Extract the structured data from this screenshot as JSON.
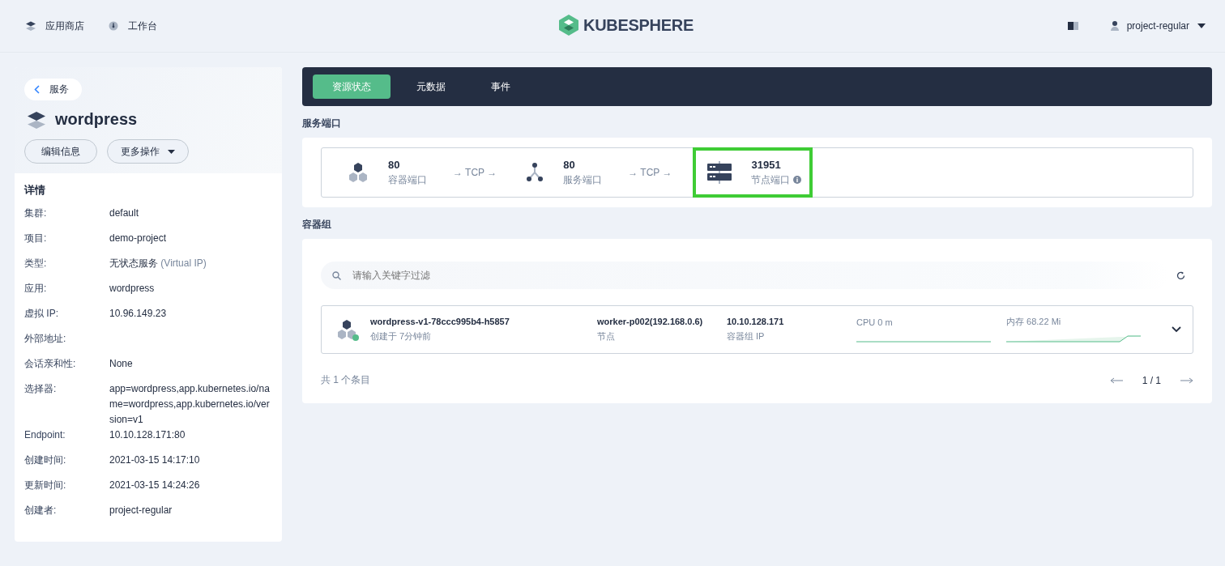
{
  "header": {
    "nav": [
      {
        "label": "应用商店",
        "kind": "store"
      },
      {
        "label": "工作台",
        "kind": "workbench"
      }
    ],
    "logo": "KUBESPHERE",
    "user": "project-regular"
  },
  "sidebar": {
    "back": "服务",
    "title": "wordpress",
    "buttons": [
      {
        "label": "编辑信息",
        "kind": "plain"
      },
      {
        "label": "更多操作",
        "kind": "dropdown"
      }
    ],
    "details_title": "详情",
    "details": [
      {
        "label": "集群:",
        "value": "default"
      },
      {
        "label": "项目:",
        "value": "demo-project"
      },
      {
        "label": "类型:",
        "value": "无状态服务",
        "note": "(Virtual IP)"
      },
      {
        "label": "应用:",
        "value": "wordpress"
      },
      {
        "label": "虚拟 IP:",
        "value": "10.96.149.23"
      },
      {
        "label": "外部地址:"
      },
      {
        "label": "会话亲和性:",
        "value": "None"
      },
      {
        "label": "选择器:",
        "value": "app=wordpress,app.kubernetes.io/name=wordpress,app.kubernetes.io/version=v1"
      },
      {
        "label": "Endpoint:",
        "value": "10.10.128.171:80"
      },
      {
        "label": "创建时间:",
        "value": "2021-03-15 14:17:10"
      },
      {
        "label": "更新时间:",
        "value": "2021-03-15 14:24:26"
      },
      {
        "label": "创建者:",
        "value": "project-regular"
      }
    ]
  },
  "tabs": [
    {
      "label": "资源状态",
      "selected": true
    },
    {
      "label": "元数据",
      "selected": false
    },
    {
      "label": "事件",
      "selected": false
    }
  ],
  "ports": {
    "title": "服务端口",
    "items": [
      {
        "kind": "container",
        "port": "80",
        "label": "容器端口",
        "highlighted": false,
        "info": false
      },
      {
        "kind": "service",
        "port": "80",
        "label": "服务端口",
        "highlighted": false,
        "info": false
      },
      {
        "kind": "node",
        "port": "31951",
        "label": "节点端口",
        "highlighted": true,
        "info": true
      }
    ],
    "protocols": [
      "→ TCP →",
      "→ TCP →"
    ]
  },
  "pods": {
    "title": "容器组",
    "search": {
      "placeholder": "请输入关键字过滤"
    },
    "rows": [
      {
        "name": "wordpress-v1-78ccc995b4-h5857",
        "created": "创建于 7分钟前",
        "color": "#55bc8a",
        "node": "worker-p002(192.168.0.6)",
        "node_label": "节点",
        "ip": "10.10.128.171",
        "ip_label": "容器组 IP",
        "cpu": "CPU 0 m",
        "memory": "内存 68.22 Mi"
      }
    ],
    "total": "共 1 个条目",
    "page": "1 / 1"
  }
}
